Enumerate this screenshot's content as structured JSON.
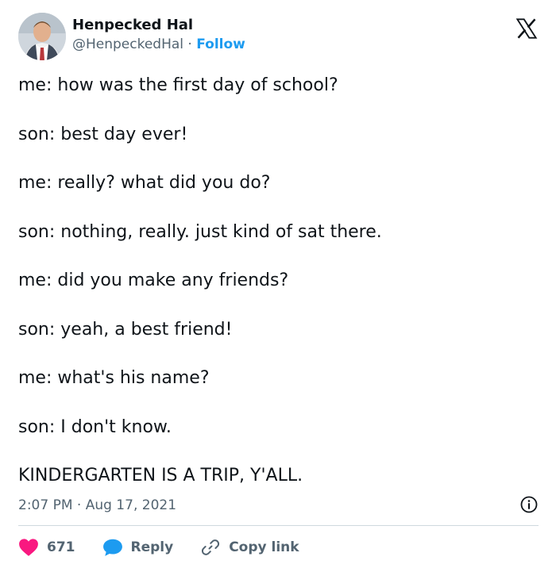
{
  "author": {
    "display_name": "Henpecked Hal",
    "handle": "@HenpeckedHal",
    "separator": " · ",
    "follow_label": "Follow"
  },
  "tweet": {
    "lines": [
      "me: how was the first day of school?",
      "son: best day ever!",
      "me: really? what did you do?",
      "son: nothing, really. just kind of sat there.",
      "me: did you make any friends?",
      "son: yeah, a best friend!",
      "me: what's his name?",
      "son: I don't know.",
      "KINDERGARTEN IS A TRIP, Y'ALL."
    ],
    "timestamp": "2:07 PM · Aug 17, 2021"
  },
  "actions": {
    "like_count": "671",
    "reply_label": "Reply",
    "copy_link_label": "Copy link"
  },
  "icons": {
    "brand": "x-logo-icon",
    "info": "info-icon",
    "like": "heart-icon",
    "reply": "speech-bubble-icon",
    "copy": "link-icon"
  },
  "colors": {
    "text": "#0f1419",
    "secondary": "#536471",
    "accent": "#1d9bf0",
    "like": "#f91880",
    "divider": "#cfd9de"
  }
}
